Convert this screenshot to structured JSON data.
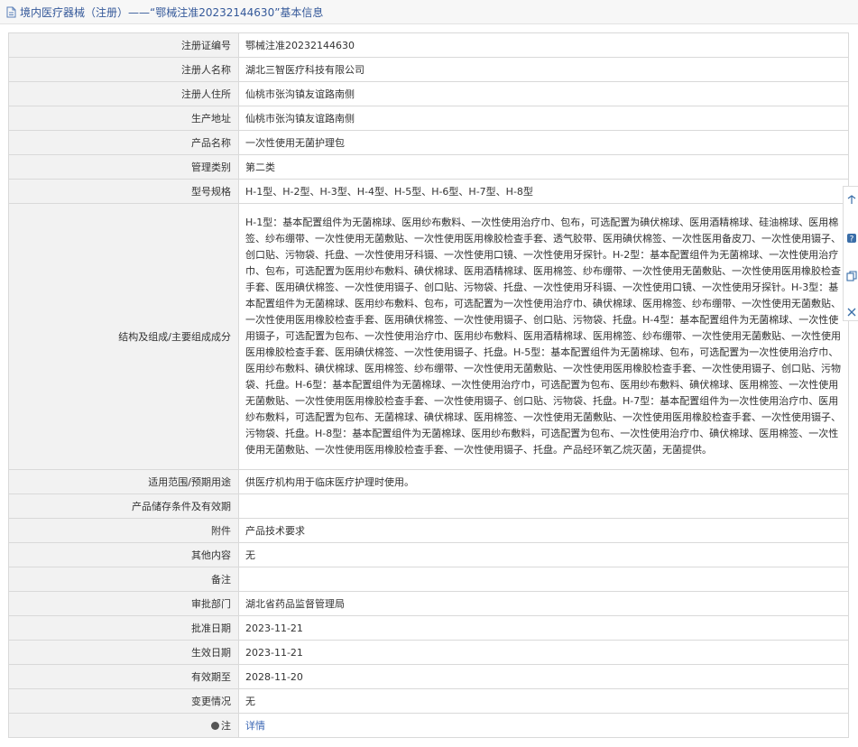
{
  "header": {
    "title": "境内医疗器械（注册）——“鄂械注准20232144630”基本信息"
  },
  "rows": [
    {
      "label": "注册证编号",
      "value": "鄂械注准20232144630"
    },
    {
      "label": "注册人名称",
      "value": "湖北三智医疗科技有限公司"
    },
    {
      "label": "注册人住所",
      "value": "仙桃市张沟镇友谊路南侧"
    },
    {
      "label": "生产地址",
      "value": "仙桃市张沟镇友谊路南侧"
    },
    {
      "label": "产品名称",
      "value": "一次性使用无菌护理包"
    },
    {
      "label": "管理类别",
      "value": "第二类"
    },
    {
      "label": "型号规格",
      "value": "H-1型、H-2型、H-3型、H-4型、H-5型、H-6型、H-7型、H-8型"
    },
    {
      "label": "结构及组成/主要组成成分",
      "value": "H-1型：基本配置组件为无菌棉球、医用纱布敷料、一次性使用治疗巾、包布，可选配置为碘伏棉球、医用酒精棉球、硅油棉球、医用棉签、纱布绷带、一次性使用无菌敷贴、一次性使用医用橡胶检查手套、透气胶带、医用碘伏棉签、一次性医用备皮刀、一次性使用镊子、创口贴、污物袋、托盘、一次性使用牙科镊、一次性使用口镜、一次性使用牙探针。H-2型：基本配置组件为无菌棉球、一次性使用治疗巾、包布，可选配置为医用纱布敷料、碘伏棉球、医用酒精棉球、医用棉签、纱布绷带、一次性使用无菌敷贴、一次性使用医用橡胶检查手套、医用碘伏棉签、一次性使用镊子、创口贴、污物袋、托盘、一次性使用牙科镊、一次性使用口镜、一次性使用牙探针。H-3型：基本配置组件为无菌棉球、医用纱布敷料、包布，可选配置为一次性使用治疗巾、碘伏棉球、医用棉签、纱布绷带、一次性使用无菌敷贴、一次性使用医用橡胶检查手套、医用碘伏棉签、一次性使用镊子、创口贴、污物袋、托盘。H-4型：基本配置组件为无菌棉球、一次性使用镊子，可选配置为包布、一次性使用治疗巾、医用纱布敷料、医用酒精棉球、医用棉签、纱布绷带、一次性使用无菌敷贴、一次性使用医用橡胶检查手套、医用碘伏棉签、一次性使用镊子、托盘。H-5型：基本配置组件为无菌棉球、包布，可选配置为一次性使用治疗巾、医用纱布敷料、碘伏棉球、医用棉签、纱布绷带、一次性使用无菌敷贴、一次性使用医用橡胶检查手套、一次性使用镊子、创口贴、污物袋、托盘。H-6型：基本配置组件为无菌棉球、一次性使用治疗巾，可选配置为包布、医用纱布敷料、碘伏棉球、医用棉签、一次性使用无菌敷贴、一次性使用医用橡胶检查手套、一次性使用镊子、创口贴、污物袋、托盘。H-7型：基本配置组件为一次性使用治疗巾、医用纱布敷料，可选配置为包布、无菌棉球、碘伏棉球、医用棉签、一次性使用无菌敷贴、一次性使用医用橡胶检查手套、一次性使用镊子、污物袋、托盘。H-8型：基本配置组件为无菌棉球、医用纱布敷料，可选配置为包布、一次性使用治疗巾、碘伏棉球、医用棉签、一次性使用无菌敷贴、一次性使用医用橡胶检查手套、一次性使用镊子、托盘。产品经环氧乙烷灭菌，无菌提供。"
    },
    {
      "label": "适用范围/预期用途",
      "value": "供医疗机构用于临床医疗护理时使用。"
    },
    {
      "label": "产品储存条件及有效期",
      "value": ""
    },
    {
      "label": "附件",
      "value": "产品技术要求"
    },
    {
      "label": "其他内容",
      "value": "无"
    },
    {
      "label": "备注",
      "value": ""
    },
    {
      "label": "审批部门",
      "value": "湖北省药品监督管理局"
    },
    {
      "label": "批准日期",
      "value": "2023-11-21"
    },
    {
      "label": "生效日期",
      "value": "2023-11-21"
    },
    {
      "label": "有效期至",
      "value": "2028-11-20"
    },
    {
      "label": "变更情况",
      "value": "无"
    },
    {
      "label": "注",
      "value": "详情"
    }
  ],
  "icons": {
    "title": "document-icon",
    "note": "pin-icon",
    "side": [
      "share-icon",
      "help-icon",
      "copy-icon",
      "close-icon"
    ]
  },
  "colors": {
    "link": "#3a66b3",
    "title": "#35599a",
    "label_bg": "#f2f2f2",
    "border": "#d9d9d9"
  }
}
